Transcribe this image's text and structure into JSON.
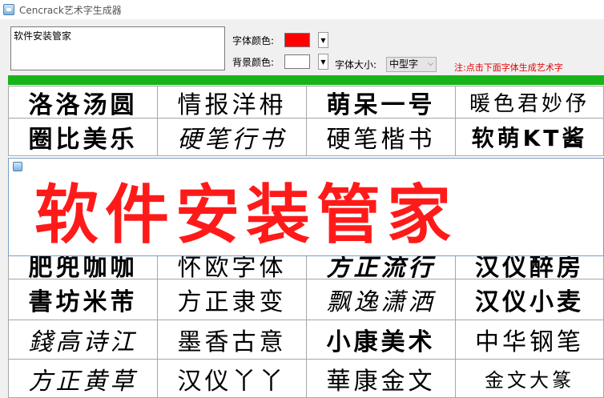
{
  "window": {
    "title": "Cencrack艺术字生成器"
  },
  "input_text": "软件安装管家",
  "controls": {
    "font_color_label": "字体颜色:",
    "font_color": "#ff0000",
    "bg_color_label": "背景颜色:",
    "bg_color": "#ffffff",
    "font_size_label": "字体大小:",
    "font_size_value": "中型字",
    "hint": "注:点击下面字体生成艺术字"
  },
  "grid": {
    "rows": [
      [
        "洛洛汤圆",
        "情报洋枏",
        "萌呆一号",
        "暖色君妙伃"
      ],
      [
        "圈比美乐",
        "硬笔行书",
        "硬笔楷书",
        "软萌KT酱"
      ],
      [
        "肥兜咖咖",
        "怀欧字体",
        "方正流行",
        "汉仪醉房"
      ],
      [
        "書坊米芾",
        "方正隶变",
        "飘逸潇洒",
        "汉仪小麦"
      ],
      [
        "錢高诗江",
        "墨香古意",
        "小康美术",
        "中华钢笔"
      ],
      [
        "方正黄草",
        "汉仪丫丫",
        "華康金文",
        "金文大篆"
      ]
    ]
  },
  "preview": {
    "text": "软件安装管家",
    "color": "#ff1a1a"
  },
  "colors": {
    "accent_green": "#18b318",
    "hint_red": "#e00000"
  }
}
